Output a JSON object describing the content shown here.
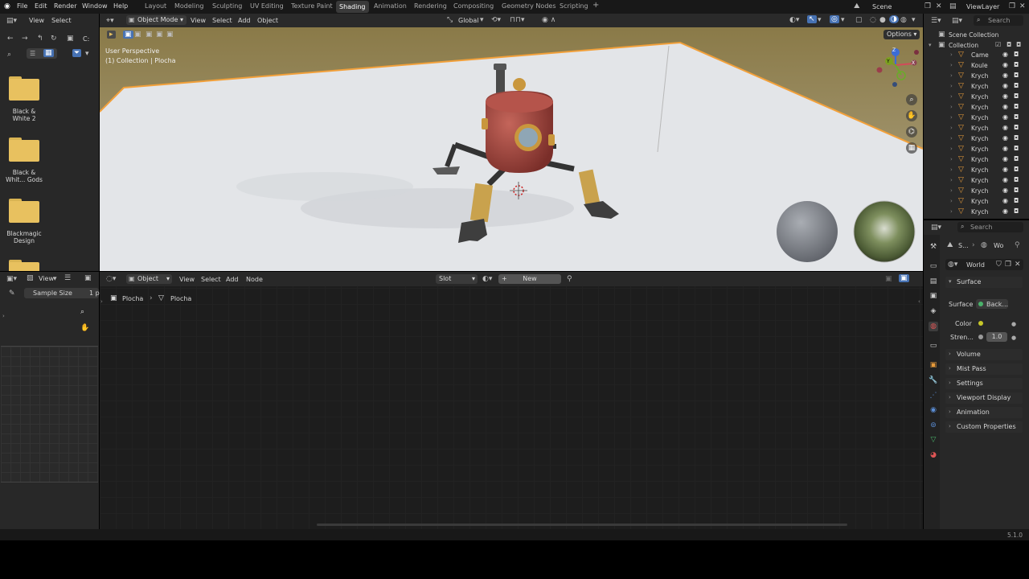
{
  "menu": {
    "file": "File",
    "edit": "Edit",
    "render": "Render",
    "window": "Window",
    "help": "Help"
  },
  "workspaces": [
    "Layout",
    "Modeling",
    "Sculpting",
    "UV Editing",
    "Texture Paint",
    "Shading",
    "Animation",
    "Rendering",
    "Compositing",
    "Geometry Nodes",
    "Scripting"
  ],
  "active_workspace": "Shading",
  "add_workspace": "+",
  "scene_name": "Scene",
  "view_layer": "ViewLayer",
  "search_placeholder": "Search",
  "file_browser": {
    "header": {
      "view": "View",
      "select": "Select"
    },
    "path": "C:",
    "folders": [
      {
        "label1": "Black &",
        "label2": "White 2"
      },
      {
        "label1": "Black &",
        "label2": "Whit... Gods"
      },
      {
        "label1": "Blackmagic",
        "label2": "Design"
      }
    ]
  },
  "viewport": {
    "mode": "Object Mode",
    "menus": [
      "View",
      "Select",
      "Add",
      "Object"
    ],
    "transform": "Global",
    "options": "Options",
    "overlay_title": "User Perspective",
    "overlay_sub": "(1) Collection | Plocha",
    "gizmo": {
      "z": "Z",
      "y": "Y",
      "x": "X"
    }
  },
  "image_panel": {
    "view": "View",
    "tool": "Sample Size",
    "tool_val": "1 p"
  },
  "node_editor": {
    "object": "Object",
    "menus": [
      "View",
      "Select",
      "Add",
      "Node"
    ],
    "slot": "Slot",
    "new_btn": "New",
    "breadcrumb1": "Plocha",
    "breadcrumb2": "Plocha"
  },
  "outliner": {
    "root": "Scene Collection",
    "collection": "Collection",
    "items": [
      "Camera",
      "Koule",
      "Krychle",
      "Krychle",
      "Krychle",
      "Krychle",
      "Krychle",
      "Krychle",
      "Krychle",
      "Krychle",
      "Krychle",
      "Krychle",
      "Krychle",
      "Krychle",
      "Krychle",
      "Krychle"
    ]
  },
  "properties": {
    "search": "Search",
    "crumb1": "S...",
    "crumb2": "Wo",
    "world_name": "World",
    "surface_panel": "Surface",
    "surface_label": "Surface",
    "surface_value": "Back...",
    "color_label": "Color",
    "strength_label": "Stren...",
    "strength_value": "1.0",
    "sections": [
      "Volume",
      "Mist Pass",
      "Settings",
      "Viewport Display",
      "Animation",
      "Custom Properties"
    ]
  },
  "version": "5.1.0",
  "colors": {
    "accent": "#4772b3",
    "active_outline": "#f2a03a",
    "folder": "#e8c15f",
    "object_icon": "#e69a3a"
  }
}
